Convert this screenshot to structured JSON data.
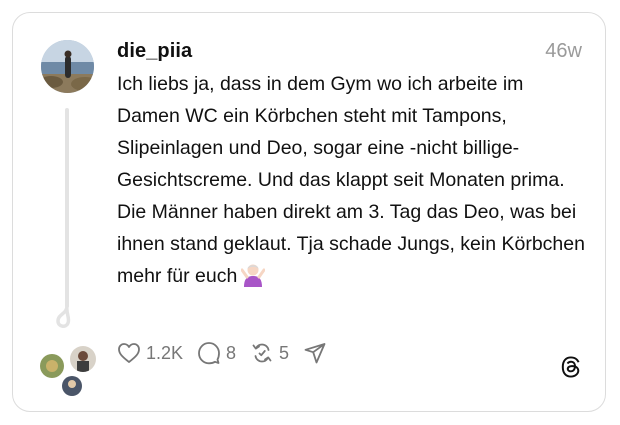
{
  "post": {
    "username": "die_piia",
    "timestamp": "46w",
    "text": "Ich liebs ja, dass in dem Gym wo ich arbeite im Damen WC ein Körbchen steht mit Tampons, Slipeinlagen und Deo, sogar eine -nicht billige- Gesichtscreme. Und das klappt seit Monaten prima.\nDie Männer haben direkt am 3. Tag das Deo, was bei ihnen stand geklaut. Tja schade Jungs, kein Körbchen mehr für euch",
    "emoji": "person-gesturing-no"
  },
  "actions": {
    "likes": "1.2K",
    "replies": "8",
    "reposts": "5"
  },
  "icons": {
    "like": "heart-icon",
    "reply": "comment-icon",
    "repost": "repost-icon",
    "share": "send-icon",
    "brand": "threads-logo-icon"
  },
  "colors": {
    "text": "#101010",
    "muted": "#9a9a9a",
    "border": "#dcdcdc"
  }
}
